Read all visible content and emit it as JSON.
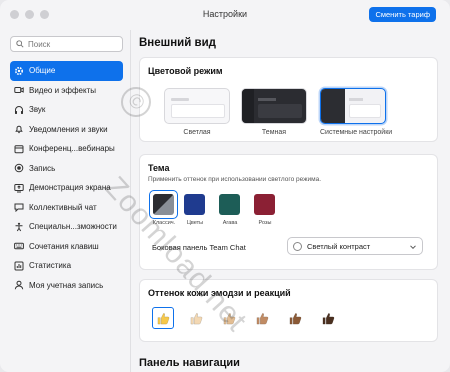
{
  "window": {
    "title": "Настройки",
    "upgrade_label": "Сменить тариф"
  },
  "search": {
    "placeholder": "Поиск"
  },
  "sidebar": {
    "items": [
      {
        "label": "Общие",
        "icon": "gear-icon",
        "active": true
      },
      {
        "label": "Видео и эффекты",
        "icon": "video-icon"
      },
      {
        "label": "Звук",
        "icon": "headphones-icon"
      },
      {
        "label": "Уведомления и звуки",
        "icon": "bell-icon"
      },
      {
        "label": "Конференц...вебинары",
        "icon": "calendar-icon"
      },
      {
        "label": "Запись",
        "icon": "record-icon"
      },
      {
        "label": "Демонстрация экрана",
        "icon": "share-screen-icon"
      },
      {
        "label": "Коллективный чат",
        "icon": "chat-icon"
      },
      {
        "label": "Специальн...зможности",
        "icon": "accessibility-icon"
      },
      {
        "label": "Сочетания клавиш",
        "icon": "keyboard-icon"
      },
      {
        "label": "Статистика",
        "icon": "statistics-icon"
      },
      {
        "label": "Моя учетная запись",
        "icon": "account-icon"
      }
    ]
  },
  "main": {
    "heading": "Внешний вид",
    "color_mode": {
      "title": "Цветовой режим",
      "options": [
        {
          "label": "Светлая"
        },
        {
          "label": "Темная"
        },
        {
          "label": "Системные настройки",
          "selected": true
        }
      ]
    },
    "theme": {
      "title": "Тема",
      "subtitle": "Применить оттенок при использовании светлого режима.",
      "swatches": [
        {
          "label": "Классич.",
          "color": "#8a8f97",
          "selected": true
        },
        {
          "label": "Цветы",
          "color": "#1f3b8f"
        },
        {
          "label": "Агава",
          "color": "#1d5d57"
        },
        {
          "label": "Розы",
          "color": "#8b2034"
        }
      ],
      "side_panel_label": "Боковая панель Team Chat",
      "side_panel_value": "Светлый контраст"
    },
    "skin_tone": {
      "title": "Оттенок кожи эмодзи и реакций",
      "tones": [
        "#f6c84a",
        "#f3d8b3",
        "#e2bd93",
        "#c08b64",
        "#8b5a36",
        "#4b3020"
      ]
    },
    "nav_heading": "Панель навигации"
  },
  "watermark": {
    "text": "Zoomload.net",
    "symbol": "©"
  },
  "colors": {
    "accent": "#0e71eb"
  }
}
